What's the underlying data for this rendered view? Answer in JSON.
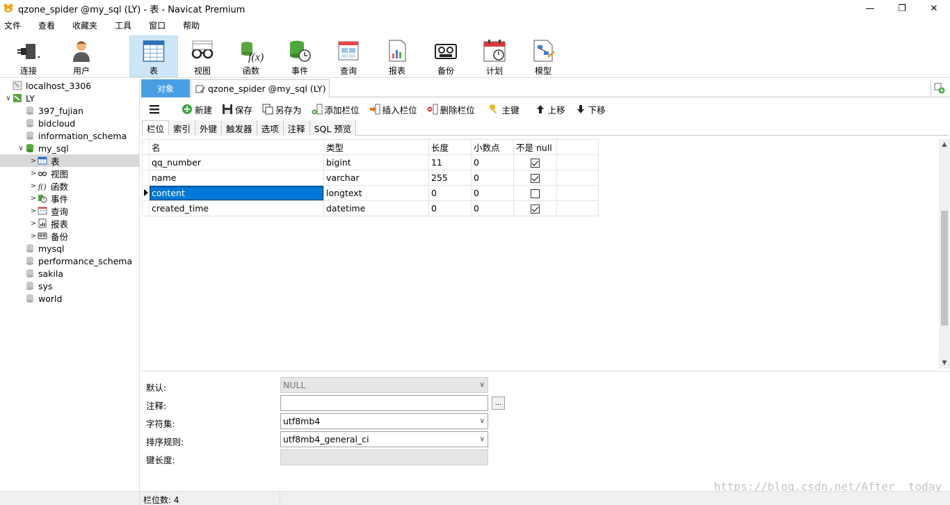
{
  "window": {
    "title": "qzone_spider @my_sql (LY) - 表 - Navicat Premium",
    "controls": [
      "—",
      "❐",
      "✕"
    ]
  },
  "menu": [
    "文件",
    "查看",
    "收藏夹",
    "工具",
    "窗口",
    "帮助"
  ],
  "toolbar": [
    {
      "label": "连接",
      "icon": "plug-icon"
    },
    {
      "label": "用户",
      "icon": "user-icon"
    },
    {
      "label": "表",
      "icon": "table-icon",
      "active": true
    },
    {
      "label": "视图",
      "icon": "glasses-icon"
    },
    {
      "label": "函数",
      "icon": "function-icon"
    },
    {
      "label": "事件",
      "icon": "event-icon"
    },
    {
      "label": "查询",
      "icon": "query-icon"
    },
    {
      "label": "报表",
      "icon": "report-icon"
    },
    {
      "label": "备份",
      "icon": "backup-icon"
    },
    {
      "label": "计划",
      "icon": "calendar-icon"
    },
    {
      "label": "模型",
      "icon": "model-icon"
    }
  ],
  "tree": [
    {
      "label": "localhost_3306",
      "level": 0,
      "arrow": "",
      "icon": "server-icon"
    },
    {
      "label": "LY",
      "level": 0,
      "arrow": "∨",
      "icon": "server-active-icon"
    },
    {
      "label": "397_fujian",
      "level": 1,
      "arrow": "",
      "icon": "database-icon"
    },
    {
      "label": "bidcloud",
      "level": 1,
      "arrow": "",
      "icon": "database-icon"
    },
    {
      "label": "information_schema",
      "level": 1,
      "arrow": "",
      "icon": "database-icon"
    },
    {
      "label": "my_sql",
      "level": 1,
      "arrow": "∨",
      "icon": "database-open-icon"
    },
    {
      "label": "表",
      "level": 2,
      "arrow": ">",
      "icon": "table-icon",
      "selected": true
    },
    {
      "label": "视图",
      "level": 2,
      "arrow": ">",
      "icon": "glasses-icon"
    },
    {
      "label": "函数",
      "level": 2,
      "arrow": ">",
      "icon": "function-icon"
    },
    {
      "label": "事件",
      "level": 2,
      "arrow": ">",
      "icon": "event-icon"
    },
    {
      "label": "查询",
      "level": 2,
      "arrow": ">",
      "icon": "query-icon"
    },
    {
      "label": "报表",
      "level": 2,
      "arrow": ">",
      "icon": "report-icon"
    },
    {
      "label": "备份",
      "level": 2,
      "arrow": ">",
      "icon": "backup-icon"
    },
    {
      "label": "mysql",
      "level": 1,
      "arrow": "",
      "icon": "database-icon"
    },
    {
      "label": "performance_schema",
      "level": 1,
      "arrow": "",
      "icon": "database-icon"
    },
    {
      "label": "sakila",
      "level": 1,
      "arrow": "",
      "icon": "database-icon"
    },
    {
      "label": "sys",
      "level": 1,
      "arrow": "",
      "icon": "database-icon"
    },
    {
      "label": "world",
      "level": 1,
      "arrow": "",
      "icon": "database-icon"
    }
  ],
  "tabs": {
    "objects": "对象",
    "document": "qzone_spider @my_sql (LY)"
  },
  "actions": [
    "新建",
    "保存",
    "另存为",
    "添加栏位",
    "插入栏位",
    "删除栏位",
    "主键",
    "上移",
    "下移"
  ],
  "subtabs": [
    "栏位",
    "索引",
    "外键",
    "触发器",
    "选项",
    "注释",
    "SQL 预览"
  ],
  "grid": {
    "headers": [
      "名",
      "类型",
      "长度",
      "小数点",
      "不是 null"
    ],
    "rows": [
      {
        "name": "qq_number",
        "type": "bigint",
        "length": "11",
        "decimals": "0",
        "not_null": true
      },
      {
        "name": "name",
        "type": "varchar",
        "length": "255",
        "decimals": "0",
        "not_null": true
      },
      {
        "name": "content",
        "type": "longtext",
        "length": "0",
        "decimals": "0",
        "not_null": false,
        "selected": true
      },
      {
        "name": "created_time",
        "type": "datetime",
        "length": "0",
        "decimals": "0",
        "not_null": true
      }
    ]
  },
  "props": {
    "default_label": "默认:",
    "default_value": "NULL",
    "comment_label": "注释:",
    "comment_value": "",
    "charset_label": "字符集:",
    "charset_value": "utf8mb4",
    "collation_label": "排序规则:",
    "collation_value": "utf8mb4_general_ci",
    "keylen_label": "键长度:",
    "keylen_value": "",
    "dots": "..."
  },
  "status": {
    "field_count": "栏位数: 4"
  },
  "watermark": "https://blog.csdn.net/After__today"
}
